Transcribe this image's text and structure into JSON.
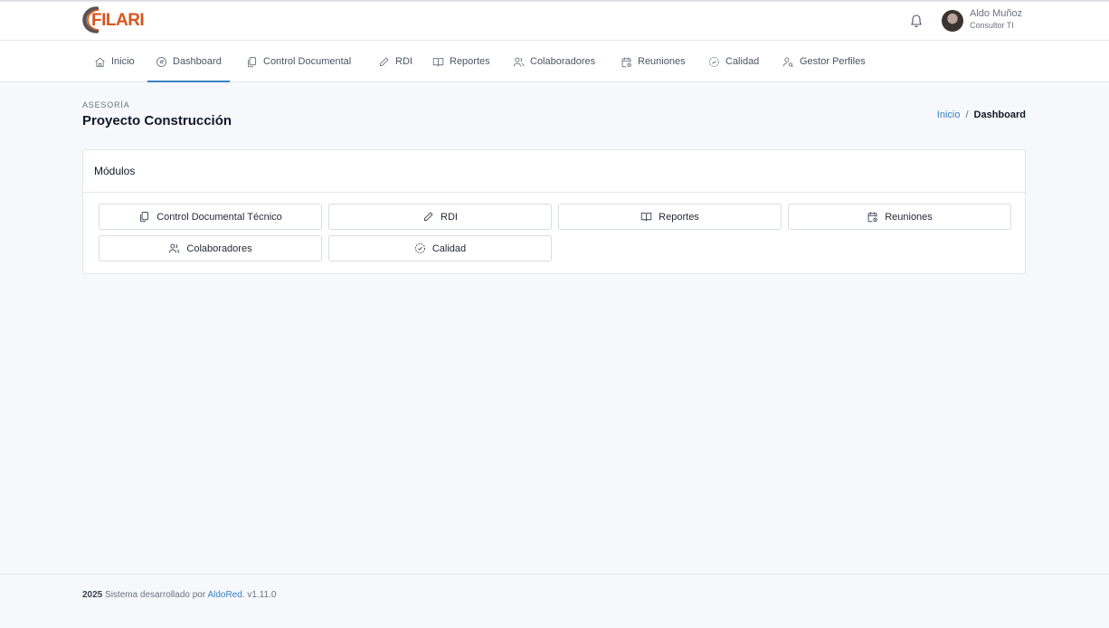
{
  "brand": {
    "logo_text": "FILARI",
    "accent": "#d9541e"
  },
  "user": {
    "name": "Aldo Muñoz",
    "role": "Consultor TI"
  },
  "nav": {
    "items": [
      {
        "label": "Inicio",
        "icon": "home-icon",
        "active": false
      },
      {
        "label": "Dashboard",
        "icon": "dashboard-icon",
        "active": true
      },
      {
        "label": "Control Documental",
        "icon": "documents-icon",
        "active": false
      },
      {
        "label": "RDI",
        "icon": "pencil-icon",
        "active": false
      },
      {
        "label": "Reportes",
        "icon": "book-icon",
        "active": false
      },
      {
        "label": "Colaboradores",
        "icon": "users-icon",
        "active": false
      },
      {
        "label": "Reuniones",
        "icon": "calendar-icon",
        "active": false
      },
      {
        "label": "Calidad",
        "icon": "badge-check-icon",
        "active": false
      },
      {
        "label": "Gestor Perfiles",
        "icon": "user-search-icon",
        "active": false
      }
    ],
    "active_color": "#3b82c4"
  },
  "page": {
    "section": "ASESORÍA",
    "title": "Proyecto Construcción",
    "breadcrumb": {
      "home": "Inicio",
      "separator": "/",
      "current": "Dashboard"
    }
  },
  "modules": {
    "title": "Módulos",
    "buttons": [
      {
        "label": "Control Documental Técnico",
        "icon": "documents-icon"
      },
      {
        "label": "RDI",
        "icon": "pencil-icon"
      },
      {
        "label": "Reportes",
        "icon": "book-icon"
      },
      {
        "label": "Reuniones",
        "icon": "calendar-icon"
      },
      {
        "label": "Colaboradores",
        "icon": "users-icon"
      },
      {
        "label": "Calidad",
        "icon": "badge-check-icon"
      }
    ]
  },
  "footer": {
    "year": "2025",
    "text": "Sistema desarrollado por",
    "link": "AldoRed",
    "version": ". v1.11.0"
  }
}
